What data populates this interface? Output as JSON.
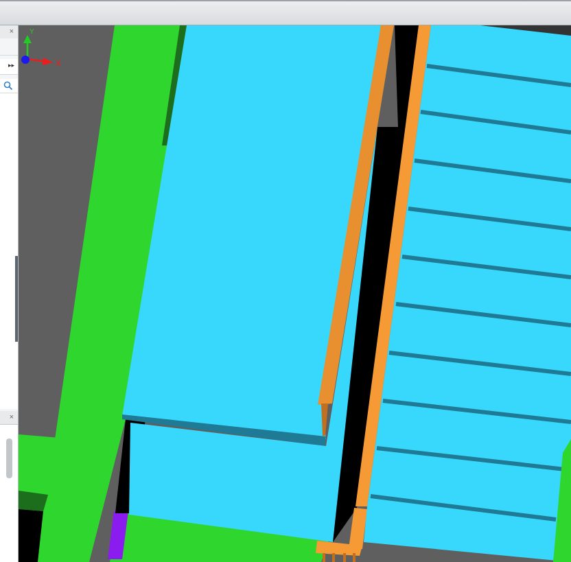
{
  "panels": {
    "top_panel": {
      "close_glyph": "×",
      "more_glyph": "▸▸",
      "search_icon": "search-icon"
    },
    "bottom_panel": {
      "close_glyph": "×"
    }
  },
  "viewport": {
    "axis_triad": {
      "x_label": "X",
      "y_label": "Y"
    },
    "colors": {
      "background": "#5f5f5f",
      "walkway": "#2ed62e",
      "walkway_dark": "#1c6e1c",
      "panel": "#38d8fd",
      "panel_edge": "#1f7a95",
      "rail": "#f59a34",
      "gap": "#000000",
      "accent": "#8a1cf0",
      "axis_x": "#ee1c1c",
      "axis_y": "#22cc22",
      "axis_z": "#1a1aee"
    }
  }
}
